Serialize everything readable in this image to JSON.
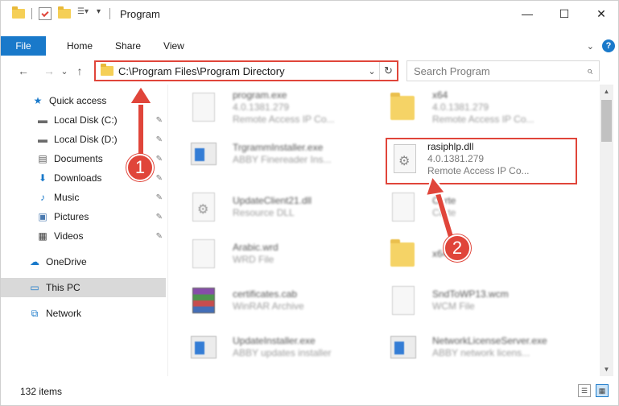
{
  "window": {
    "title": "Program",
    "controls": {
      "minimize": "—",
      "maximize": "☐",
      "close": "✕"
    }
  },
  "ribbon": {
    "tabs": [
      "File",
      "Home",
      "Share",
      "View"
    ],
    "chevron": "⌄",
    "help": "?"
  },
  "nav": {
    "back": "←",
    "forward": "→",
    "recent": "⌄",
    "up": "↑"
  },
  "address": {
    "path": "C:\\Program Files\\Program Directory",
    "dropdown": "⌄",
    "refresh": "↻"
  },
  "search": {
    "placeholder": "Search Program",
    "icon": "⌕"
  },
  "sidebar": {
    "items": [
      {
        "label": "Quick access",
        "icon": "star-icon",
        "glyph": "★",
        "color": "#1979ca",
        "pinned": false
      },
      {
        "label": "Local Disk (C:)",
        "icon": "drive-icon",
        "glyph": "▬",
        "color": "#6b6b6b",
        "pinned": true
      },
      {
        "label": "Local Disk (D:)",
        "icon": "drive-icon",
        "glyph": "▬",
        "color": "#6b6b6b",
        "pinned": true
      },
      {
        "label": "Documents",
        "icon": "documents-icon",
        "glyph": "▤",
        "color": "#5a5a5a",
        "pinned": true
      },
      {
        "label": "Downloads",
        "icon": "download-icon",
        "glyph": "⬇",
        "color": "#1979ca",
        "pinned": true
      },
      {
        "label": "Music",
        "icon": "music-icon",
        "glyph": "♪",
        "color": "#1979ca",
        "pinned": true
      },
      {
        "label": "Pictures",
        "icon": "pictures-icon",
        "glyph": "▣",
        "color": "#4a7ab0",
        "pinned": true
      },
      {
        "label": "Videos",
        "icon": "videos-icon",
        "glyph": "▦",
        "color": "#3a3a3a",
        "pinned": true
      },
      {
        "label": "OneDrive",
        "icon": "cloud-icon",
        "glyph": "☁",
        "color": "#1979ca",
        "pinned": false
      },
      {
        "label": "This PC",
        "icon": "computer-icon",
        "glyph": "▭",
        "color": "#1979ca",
        "pinned": false
      },
      {
        "label": "Network",
        "icon": "network-icon",
        "glyph": "⧉",
        "color": "#1979ca",
        "pinned": false
      }
    ],
    "pin_glyph": "📌"
  },
  "files": [
    {
      "name": "program.exe",
      "version": "4.0.1381.279",
      "desc": "Remote Access IP Co...",
      "kind": "doc",
      "blur": true
    },
    {
      "name": "x64",
      "version": "4.0.1381.279",
      "desc": "Remote Access IP Co...",
      "kind": "folder",
      "blur": true
    },
    {
      "name": "TrgrammInstaller.exe",
      "version": "ABBY Finereader Ins...",
      "desc": "",
      "kind": "exe",
      "blur": true
    },
    {
      "name": "rasiphlp.dll",
      "version": "4.0.1381.279",
      "desc": "Remote Access IP Co...",
      "kind": "dll",
      "blur": false
    },
    {
      "name": "UpdateClient21.dll",
      "version": "Resource DLL",
      "desc": "",
      "kind": "dll",
      "blur": true
    },
    {
      "name": "Carte",
      "version": "Carte",
      "desc": "",
      "kind": "doc",
      "blur": true
    },
    {
      "name": "Arabic.wrd",
      "version": "WRD File",
      "desc": "",
      "kind": "doc",
      "blur": true
    },
    {
      "name": "x64",
      "version": "",
      "desc": "",
      "kind": "folder",
      "blur": true
    },
    {
      "name": "certificates.cab",
      "version": "WinRAR Archive",
      "desc": "",
      "kind": "rar",
      "blur": true
    },
    {
      "name": "SndToWP13.wcm",
      "version": "WCM File",
      "desc": "",
      "kind": "doc",
      "blur": true
    },
    {
      "name": "UpdateInstaller.exe",
      "version": "ABBY updates installer",
      "desc": "",
      "kind": "exe",
      "blur": true
    },
    {
      "name": "NetworkLicenseServer.exe",
      "version": "ABBY network licens...",
      "desc": "",
      "kind": "exe",
      "blur": true
    }
  ],
  "status": {
    "count": "132 items"
  },
  "annotations": {
    "step1": "1",
    "step2": "2",
    "accent": "#e0453a"
  }
}
